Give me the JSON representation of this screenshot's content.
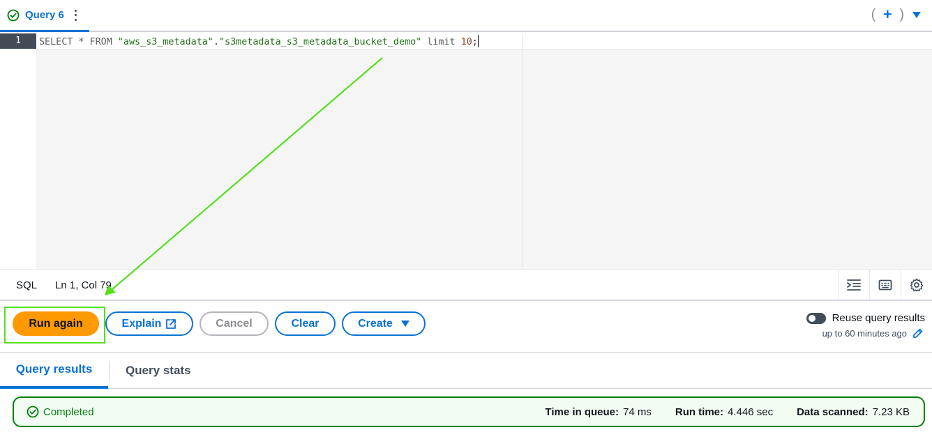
{
  "tab": {
    "label": "Query 6",
    "open_paren": "(",
    "close_paren": ")"
  },
  "editor": {
    "line_number": "1",
    "code": {
      "kw1": "SELECT * FROM ",
      "str1": "\"aws_s3_metadata\"",
      "dot": ".",
      "str2": "\"s3metadata_s3_metadata_bucket_demo\"",
      "kw2": " limit ",
      "num": "10",
      "end": ";"
    }
  },
  "statusbar": {
    "language": "SQL",
    "position": "Ln 1, Col 79",
    "icons": [
      "format-icon",
      "keyboard-icon",
      "settings-icon"
    ]
  },
  "actions": {
    "run_label": "Run again",
    "explain_label": "Explain",
    "cancel_label": "Cancel",
    "clear_label": "Clear",
    "create_label": "Create",
    "reuse_label": "Reuse query results",
    "reuse_sub": "up to 60 minutes ago",
    "reuse_enabled": false
  },
  "results": {
    "tabs": [
      "Query results",
      "Query stats"
    ],
    "status": "Completed",
    "time_in_queue_label": "Time in queue:",
    "time_in_queue_value": "74 ms",
    "run_time_label": "Run time:",
    "run_time_value": "4.446 sec",
    "data_scanned_label": "Data scanned:",
    "data_scanned_value": "7.23 KB"
  },
  "colors": {
    "accent": "#0972d3",
    "primary_button": "#ff9900",
    "success": "#037f0c",
    "annotation": "#55e01a"
  }
}
